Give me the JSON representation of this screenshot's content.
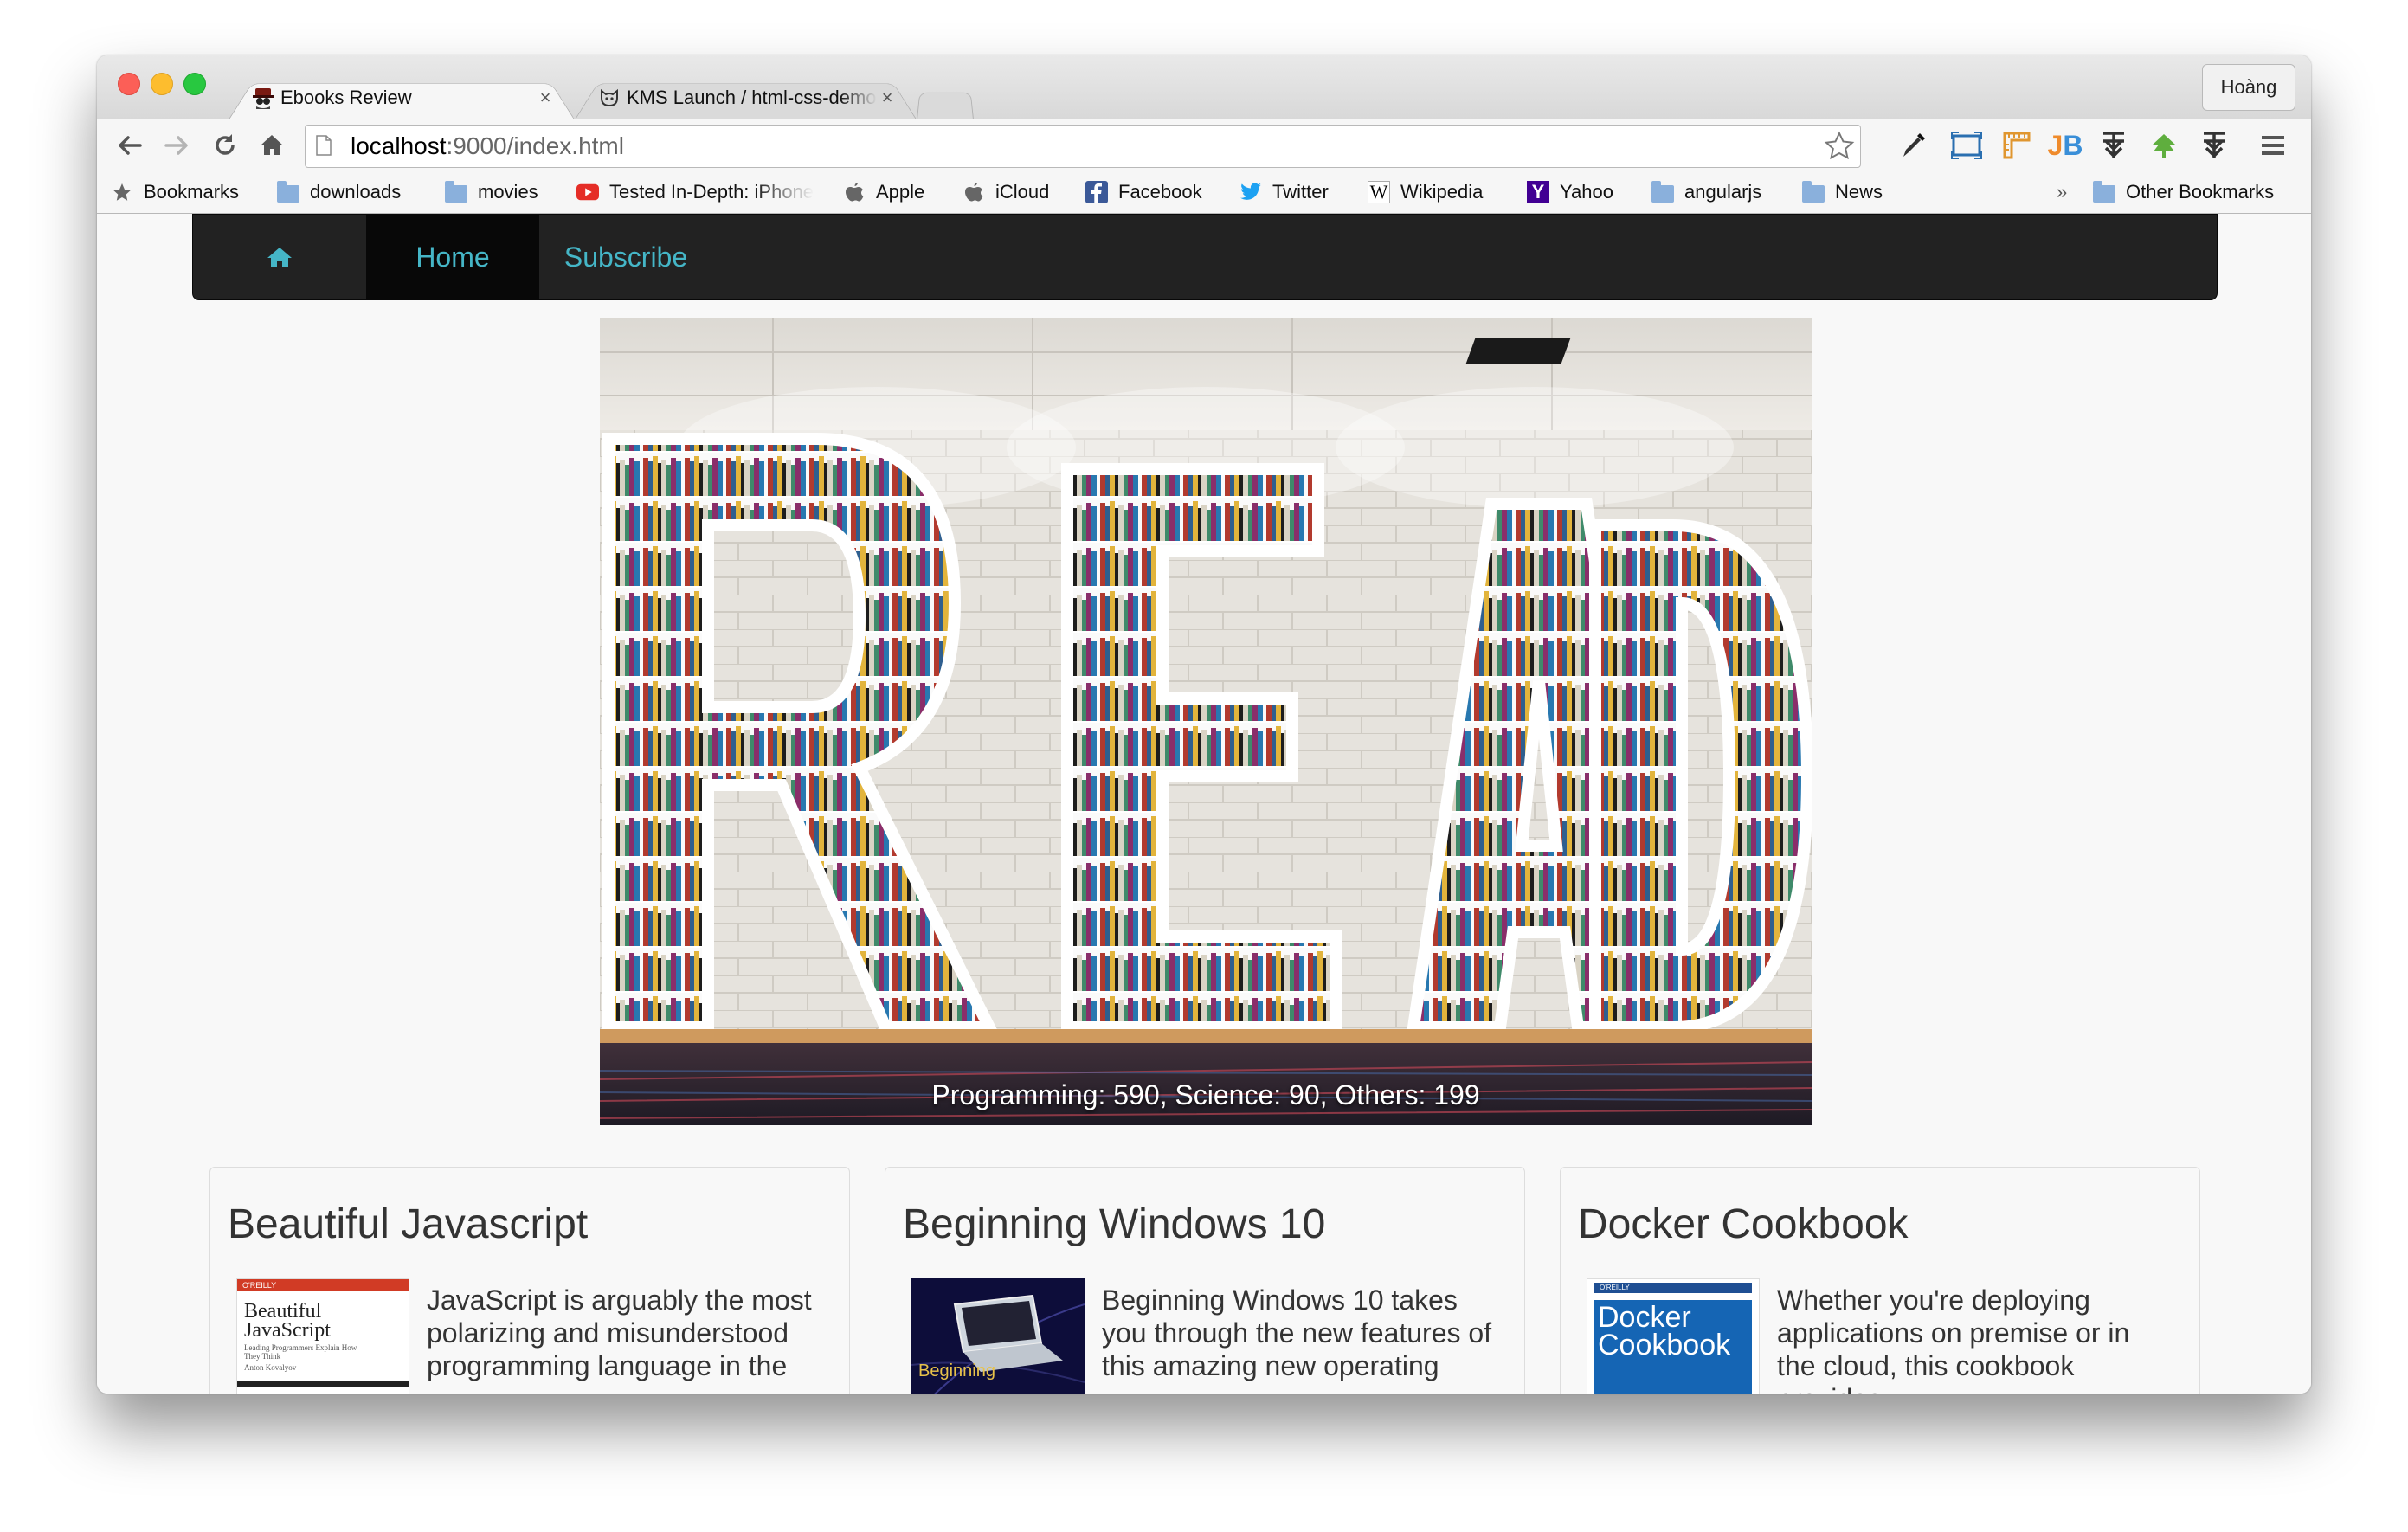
{
  "browser": {
    "tabs": [
      {
        "title": "Ebooks Review",
        "close": "×",
        "active": true
      },
      {
        "title": "KMS Launch / html-css-demo",
        "close": "×",
        "active": false
      }
    ],
    "profile": "Hoàng",
    "address": {
      "host": "localhost",
      "rest": ":9000/index.html"
    },
    "toolbar_icons": [
      "back-icon",
      "forward-icon",
      "reload-icon",
      "home-icon",
      "star-icon",
      "eyedropper-icon",
      "screen-capture-icon",
      "ruler-icon",
      "jetbrains-icon",
      "extension-icon",
      "green-extension-icon",
      "extension-icon",
      "menu-icon"
    ],
    "bookmarks": [
      {
        "label": "Bookmarks",
        "icon": "star-icon"
      },
      {
        "label": "downloads",
        "icon": "folder-icon"
      },
      {
        "label": "movies",
        "icon": "folder-icon"
      },
      {
        "label": "Tested In-Depth: iPhone",
        "icon": "youtube-icon"
      },
      {
        "label": "Apple",
        "icon": "apple-icon"
      },
      {
        "label": "iCloud",
        "icon": "apple-icon"
      },
      {
        "label": "Facebook",
        "icon": "facebook-icon"
      },
      {
        "label": "Twitter",
        "icon": "twitter-icon"
      },
      {
        "label": "Wikipedia",
        "icon": "wikipedia-icon"
      },
      {
        "label": "Yahoo",
        "icon": "yahoo-icon"
      },
      {
        "label": "angularjs",
        "icon": "folder-icon"
      },
      {
        "label": "News",
        "icon": "folder-icon"
      }
    ],
    "bookmarks_overflow": "»",
    "other_bookmarks": "Other Bookmarks"
  },
  "site": {
    "nav": {
      "home_icon": "home-icon",
      "items": [
        "Home",
        "Subscribe"
      ],
      "active": "Home"
    },
    "hero": {
      "caption": "Programming: 590, Science: 90, Others: 199",
      "image": "bookshelf-read-letters"
    },
    "cards": [
      {
        "title": "Beautiful Javascript",
        "description": "JavaScript is arguably the most polarizing and misunderstood programming language in the",
        "cover": {
          "publisher": "O'REILLY",
          "title": "Beautiful JavaScript",
          "subtitle": "Leading Programmers Explain How They Think",
          "author": "Anton Kovalyov"
        }
      },
      {
        "title": "Beginning Windows 10",
        "description": "Beginning Windows 10 takes you through the new features of this amazing new operating",
        "cover": {
          "title": "Beginning"
        }
      },
      {
        "title": "Docker Cookbook",
        "description": "Whether you're deploying applications on premise or in the cloud, this cookbook provides",
        "cover": {
          "publisher": "O'REILLY",
          "title": "Docker Cookbook"
        }
      }
    ]
  },
  "colors": {
    "nav_bg": "#222222",
    "nav_link": "#45b6c7",
    "nav_active_bg": "#080808"
  }
}
